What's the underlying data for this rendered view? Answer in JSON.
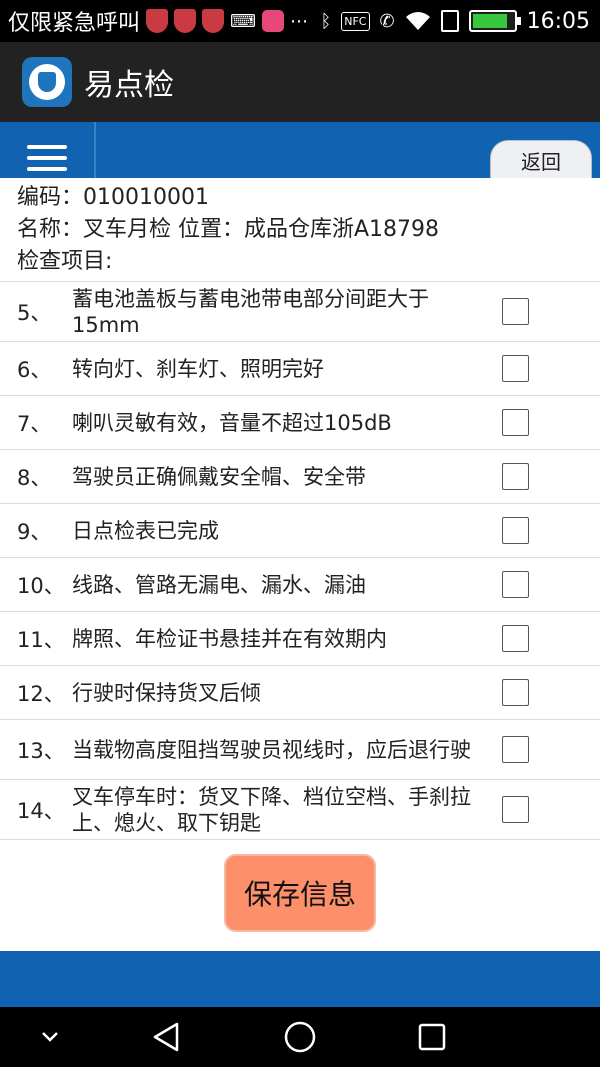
{
  "status_bar": {
    "carrier": "仅限紧急呼叫",
    "time": "16:05",
    "battery_level": 0.85,
    "icons": [
      "shield-icon",
      "shield-icon",
      "shield-icon",
      "keyboard-icon",
      "game-icon",
      "more-icon",
      "bluetooth-icon",
      "nfc-icon",
      "vibrate-icon",
      "wifi-icon",
      "sim-icon",
      "battery-icon"
    ]
  },
  "app": {
    "title": "易点检",
    "logo_icon": "app-logo-shield"
  },
  "toolbar": {
    "menu_icon": "hamburger-menu-icon",
    "back_label": "返回"
  },
  "info": {
    "code": "编码：010010001",
    "name_location": "名称：叉车月检  位置：成品仓库浙A18798",
    "items_label": "检查项目:"
  },
  "items": [
    {
      "num": "5、",
      "text": "蓄电池盖板与蓄电池带电部分间距大于15mm",
      "checked": false
    },
    {
      "num": "6、",
      "text": "转向灯、刹车灯、照明完好",
      "checked": false
    },
    {
      "num": "7、",
      "text": "喇叭灵敏有效，音量不超过105dB",
      "checked": false
    },
    {
      "num": "8、",
      "text": "驾驶员正确佩戴安全帽、安全带",
      "checked": false
    },
    {
      "num": "9、",
      "text": "日点检表已完成",
      "checked": false
    },
    {
      "num": "10、",
      "text": "线路、管路无漏电、漏水、漏油",
      "checked": false
    },
    {
      "num": "11、",
      "text": "牌照、年检证书悬挂并在有效期内",
      "checked": false
    },
    {
      "num": "12、",
      "text": "行驶时保持货叉后倾",
      "checked": false
    },
    {
      "num": "13、",
      "text": "当载物高度阻挡驾驶员视线时，应后退行驶",
      "checked": false
    },
    {
      "num": "14、",
      "text": "叉车停车时：货叉下降、档位空档、手刹拉上、熄火、取下钥匙",
      "checked": false
    }
  ],
  "save_label": "保存信息",
  "colors": {
    "toolbar_blue": "#1162b0",
    "save_button": "#fd8f6b",
    "battery_green": "#37c83e"
  }
}
